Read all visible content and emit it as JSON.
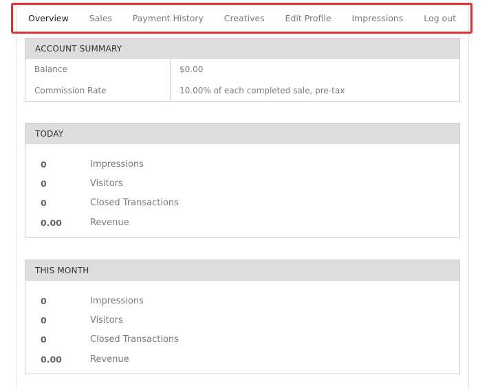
{
  "nav": {
    "tabs": [
      {
        "label": "Overview",
        "active": true
      },
      {
        "label": "Sales"
      },
      {
        "label": "Payment History"
      },
      {
        "label": "Creatives"
      },
      {
        "label": "Edit Profile"
      },
      {
        "label": "Impressions"
      },
      {
        "label": "Log out"
      }
    ],
    "highlight_color": "#e03131"
  },
  "account_summary": {
    "title": "ACCOUNT SUMMARY",
    "rows": [
      {
        "label": "Balance",
        "value": "$0.00"
      },
      {
        "label": "Commission Rate",
        "value": "10.00% of each completed sale, pre-tax"
      }
    ]
  },
  "today": {
    "title": "TODAY",
    "stats": [
      {
        "value": "0",
        "label": "Impressions"
      },
      {
        "value": "0",
        "label": "Visitors"
      },
      {
        "value": "0",
        "label": "Closed Transactions"
      },
      {
        "value": "0.00",
        "label": "Revenue"
      }
    ]
  },
  "this_month": {
    "title": "THIS MONTH",
    "stats": [
      {
        "value": "0",
        "label": "Impressions"
      },
      {
        "value": "0",
        "label": "Visitors"
      },
      {
        "value": "0",
        "label": "Closed Transactions"
      },
      {
        "value": "0.00",
        "label": "Revenue"
      }
    ]
  }
}
